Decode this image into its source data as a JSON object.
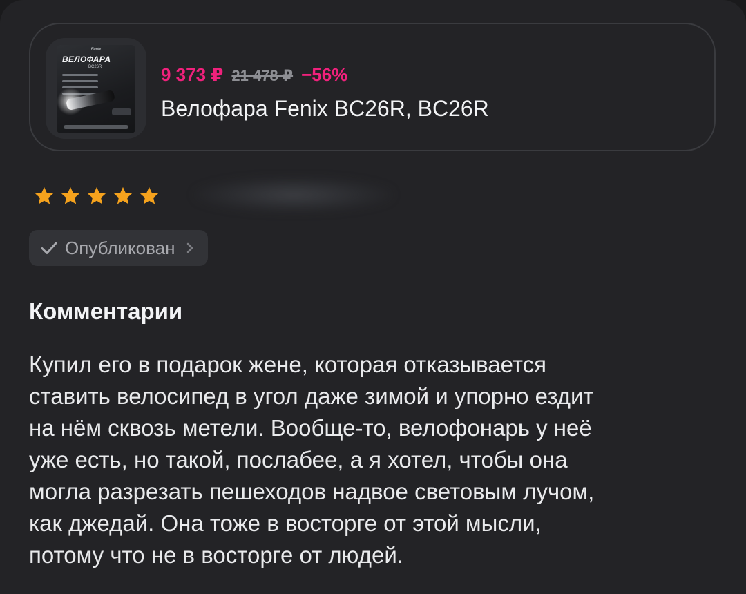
{
  "product": {
    "thumbnail": {
      "brand_text": "Fenix",
      "title_text": "ВЕЛОФАРА",
      "sub_text": "BC26R"
    },
    "price_current": "9 373 ₽",
    "price_old": "21 478 ₽",
    "discount": "−56%",
    "title": "Велофара Fenix BC26R, BC26R"
  },
  "review": {
    "rating": 5,
    "rating_max": 5,
    "star_icon": "star-icon",
    "star_color": "#f5a21d",
    "status": {
      "icon": "check-icon",
      "label": "Опубликован",
      "chevron": "chevron-right-icon"
    }
  },
  "comments": {
    "heading": "Комментарии",
    "lines": [
      "Купил его в подарок жене, которая отказывается",
      "ставить велосипед в угол даже зимой и упорно ездит",
      "на нём сквозь метели. Вообще-то, велофонарь у неё",
      "уже есть, но такой, послабее, а я хотел, чтобы она",
      "могла разрезать пешеходов надвое световым лучом,",
      "как джедай. Она тоже в восторге от этой мысли,",
      "потому что не в восторге от людей."
    ]
  },
  "colors": {
    "background": "#232326",
    "accent_price": "#f0217c",
    "muted_text": "#8d8e93",
    "chip_background": "#323337"
  }
}
